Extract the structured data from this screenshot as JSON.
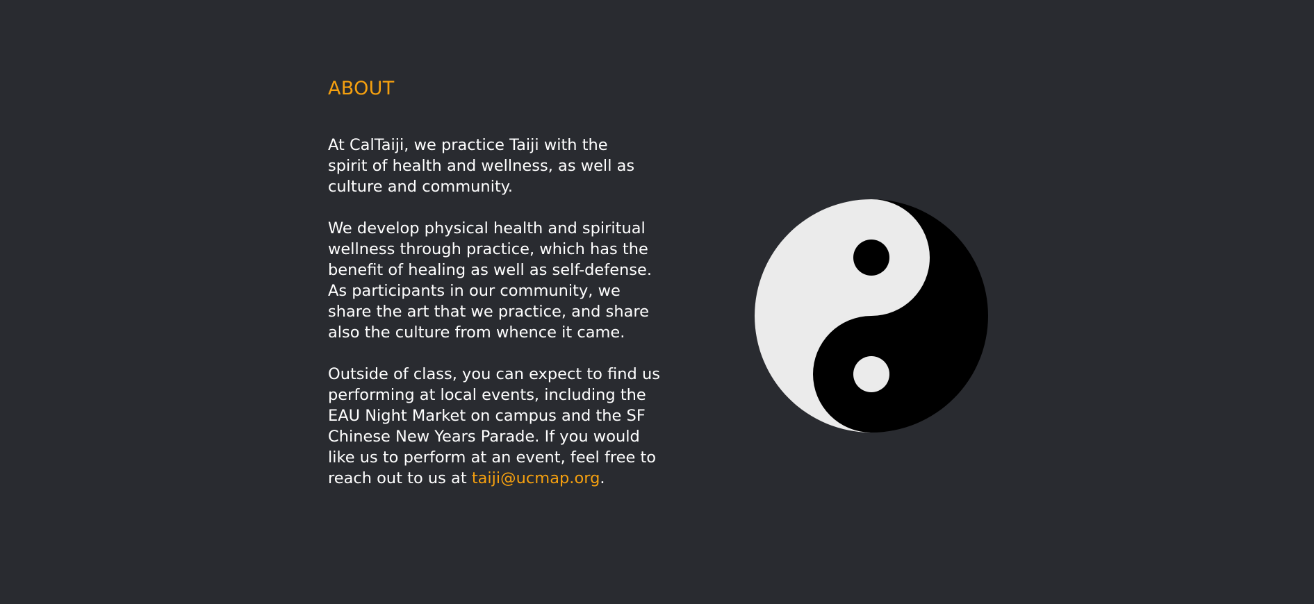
{
  "about": {
    "title": "ABOUT",
    "paragraph1_lines": [
      "At CalTaiji, we practice Taiji with the",
      "spirit of health and wellness, as well as",
      "culture and community."
    ],
    "paragraph2_lines": [
      "We develop physical health and spiritual",
      "wellness through practice, which has the",
      "benefit of healing as well as self-defense.",
      "As participants in our community, we",
      "share the art that we practice, and share",
      "also the culture from whence it came."
    ],
    "paragraph3_lines": [
      "Outside of class, you can expect to find us",
      "performing at local events, including the",
      "EAU Night Market on campus and the SF",
      "Chinese New Years Parade. If you would",
      "like us to perform at an event, feel free to"
    ],
    "paragraph3_last_prefix": "reach out to us at ",
    "email": "taiji@ucmap.org",
    "paragraph3_last_suffix": "."
  },
  "image": {
    "icon": "yin-yang-icon"
  },
  "colors": {
    "background": "#292b30",
    "accent": "#f5a00f",
    "text": "#ffffff",
    "yin_light": "#ebebeb",
    "yang_dark": "#000000"
  }
}
